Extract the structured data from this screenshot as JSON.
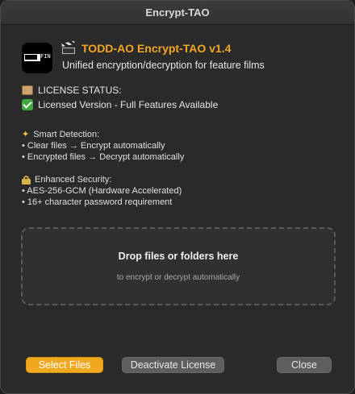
{
  "window": {
    "title": "Encrypt-TAO"
  },
  "header": {
    "icon_text": "FIN",
    "title": "TODD-AO Encrypt-TAO v1.4",
    "subtitle": "Unified encryption/decryption for feature films"
  },
  "license": {
    "heading": "LICENSE STATUS:",
    "status": "Licensed Version - Full Features Available"
  },
  "smart_detection": {
    "heading": "Smart Detection:",
    "items": [
      "• Clear files → Encrypt automatically",
      "• Encrypted files → Decrypt automatically"
    ]
  },
  "security": {
    "heading": "Enhanced Security:",
    "items": [
      "• AES-256-GCM (Hardware Accelerated)",
      "• 16+ character password requirement"
    ]
  },
  "dropzone": {
    "title": "Drop files or folders here",
    "subtitle": "to encrypt or decrypt automatically"
  },
  "buttons": {
    "select": "Select Files",
    "deactivate": "Deactivate License",
    "close": "Close"
  },
  "colors": {
    "accent": "#f0a81e",
    "title_accent": "#f5a623",
    "background": "#2a2a2a"
  }
}
